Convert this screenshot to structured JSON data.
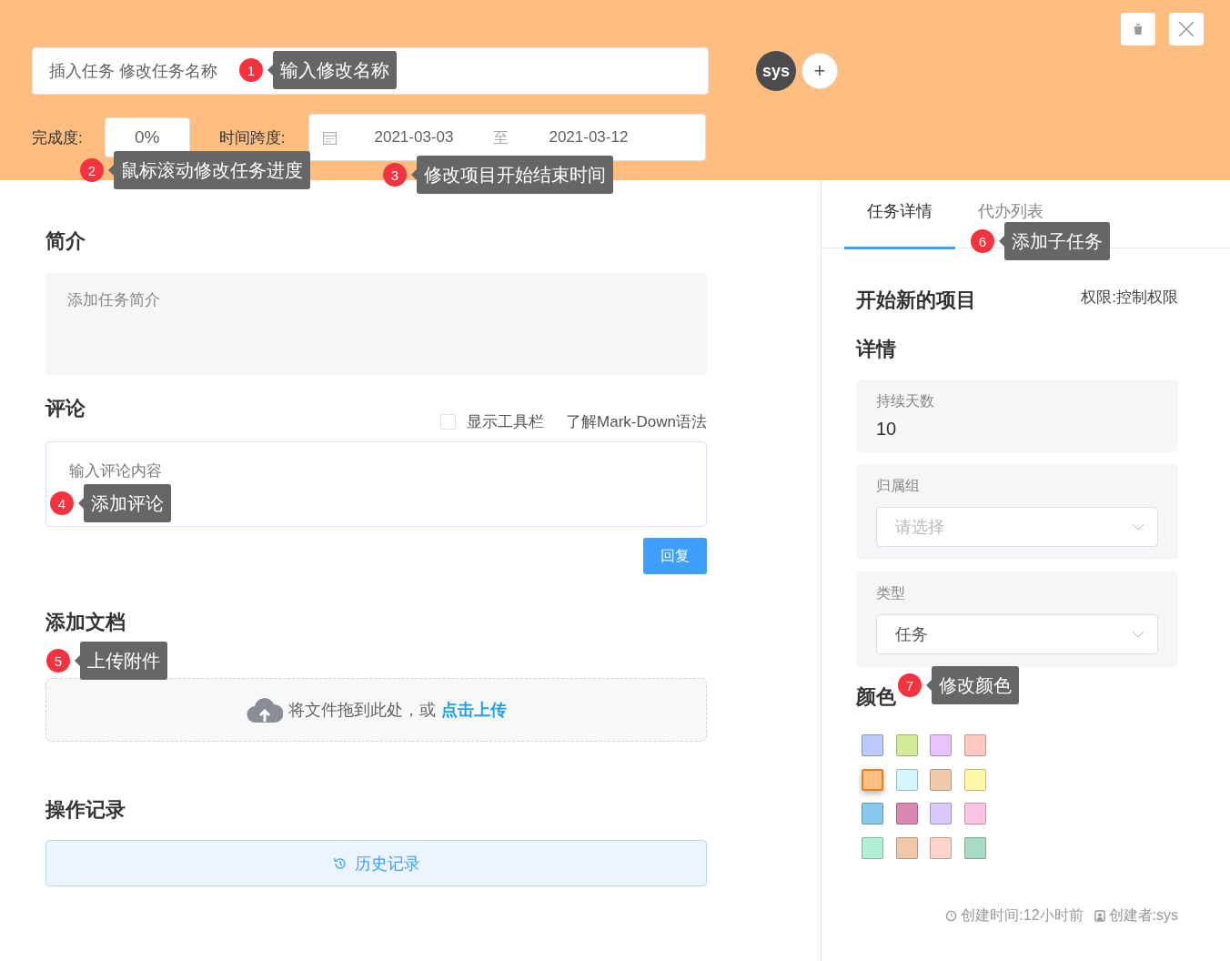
{
  "header": {
    "name_value": "插入任务 修改任务名称",
    "avatar": "sys",
    "add_member": "+",
    "progress_label": "完成度:",
    "progress_value": "0%",
    "span_label": "时间跨度:",
    "start_date": "2021-03-03",
    "range_sep": "至",
    "end_date": "2021-03-12"
  },
  "intro": {
    "title": "简介",
    "placeholder": "添加任务简介"
  },
  "comments": {
    "title": "评论",
    "toolbar_option": {
      "label": "显示工具栏",
      "checked": false
    },
    "markdown_link": "了解Mark-Down语法",
    "placeholder": "输入评论内容",
    "reply_button": "回复"
  },
  "documents": {
    "title": "添加文档",
    "drop_text": "将文件拖到此处，或",
    "upload_link": "点击上传"
  },
  "history": {
    "title": "操作记录",
    "button": "历史记录"
  },
  "tabs": [
    {
      "label": "任务详情",
      "selected": true
    },
    {
      "label": "代办列表",
      "selected": false
    }
  ],
  "detail": {
    "project_title": "开始新的项目",
    "permission": "权限:控制权限",
    "section_title": "详情",
    "duration_label": "持续天数",
    "duration_value": "10",
    "group_label": "归属组",
    "group_placeholder": "请选择",
    "type_label": "类型",
    "type_value": "任务",
    "color_title": "颜色"
  },
  "swatches": [
    {
      "color": "#bccbff",
      "selected": false
    },
    {
      "color": "#d5eb98",
      "selected": false
    },
    {
      "color": "#e9c3fc",
      "selected": false
    },
    {
      "color": "#ffc8c0",
      "selected": false
    },
    {
      "color": "#ffbf80",
      "selected": true
    },
    {
      "color": "#d3f6ff",
      "selected": false
    },
    {
      "color": "#f0c8aa",
      "selected": false
    },
    {
      "color": "#fff7a8",
      "selected": false
    },
    {
      "color": "#8ac9ee",
      "selected": false
    },
    {
      "color": "#d887b2",
      "selected": false
    },
    {
      "color": "#d8c8ff",
      "selected": false
    },
    {
      "color": "#fbc4e4",
      "selected": false
    },
    {
      "color": "#b2f0d6",
      "selected": false
    },
    {
      "color": "#f0c8aa",
      "selected": false
    },
    {
      "color": "#ffd3c8",
      "selected": false
    },
    {
      "color": "#a9dbc4",
      "selected": false
    }
  ],
  "footer": {
    "created_time": "创建时间:12小时前",
    "creator": "创建者:sys"
  },
  "callouts": [
    {
      "number": "1",
      "text": "输入修改名称"
    },
    {
      "number": "2",
      "text": "鼠标滚动修改任务进度"
    },
    {
      "number": "3",
      "text": "修改项目开始结束时间"
    },
    {
      "number": "4",
      "text": "添加评论"
    },
    {
      "number": "5",
      "text": "上传附件"
    },
    {
      "number": "6",
      "text": "添加子任务"
    },
    {
      "number": "7",
      "text": "修改颜色"
    }
  ]
}
